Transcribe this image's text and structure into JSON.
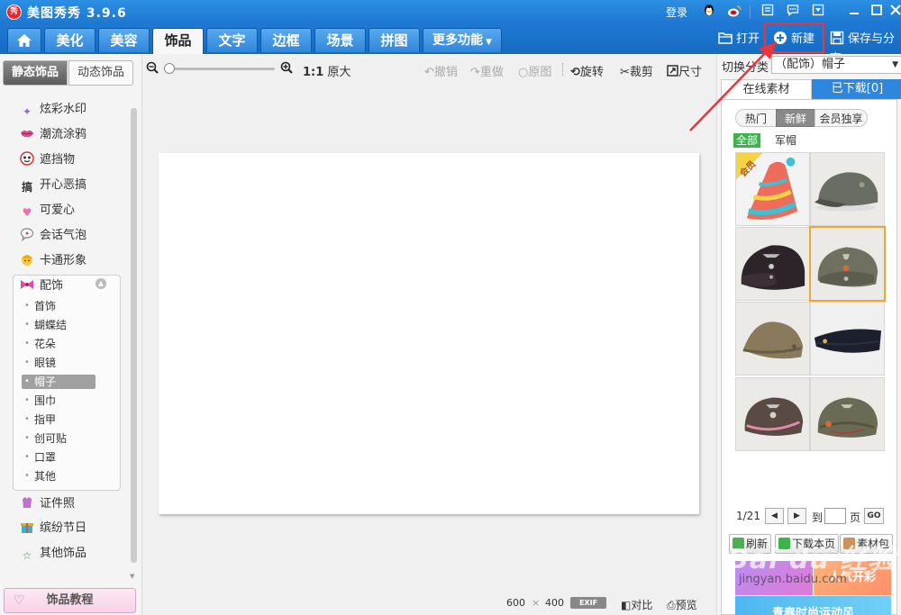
{
  "titlebar": {
    "app_title": "美图秀秀 3.9.6",
    "logo_text": "秀",
    "login": "登录"
  },
  "tabs": [
    {
      "label": "美化"
    },
    {
      "label": "美容"
    },
    {
      "label": "饰品",
      "active": true
    },
    {
      "label": "文字"
    },
    {
      "label": "边框"
    },
    {
      "label": "场景"
    },
    {
      "label": "拼图"
    }
  ],
  "more_tab": "更多功能",
  "actions": {
    "open": "打开",
    "new": "新建",
    "save_share": "保存与分享"
  },
  "left": {
    "subtab_static": "静态饰品",
    "subtab_dynamic": "动态饰品",
    "categories": [
      {
        "label": "炫彩水印",
        "icon": "sparkle-icon",
        "color": "#9a6bd8"
      },
      {
        "label": "潮流涂鸦",
        "icon": "lips-icon",
        "color": "#e04a8a"
      },
      {
        "label": "遮挡物",
        "icon": "mask-icon",
        "color": "#d33"
      },
      {
        "label": "开心恶搞",
        "icon": "prank-icon",
        "color": "#333"
      },
      {
        "label": "可爱心",
        "icon": "heart-icon",
        "color": "#f06bb0"
      },
      {
        "label": "会话气泡",
        "icon": "speech-bubble-icon",
        "color": "#888"
      },
      {
        "label": "卡通形象",
        "icon": "cartoon-icon",
        "color": "#f2a900"
      }
    ],
    "accessory_group": "配饰",
    "accessory_items": [
      "首饰",
      "蝴蝶结",
      "花朵",
      "眼镜",
      "帽子",
      "围巾",
      "指甲",
      "创可贴",
      "口罩",
      "其他"
    ],
    "selected_accessory": "帽子",
    "bottom_categories": [
      {
        "label": "证件照",
        "icon": "id-photo-icon",
        "color": "#c06fd0"
      },
      {
        "label": "缤纷节日",
        "icon": "gift-icon",
        "color": "#3bb0c9"
      },
      {
        "label": "其他饰品",
        "icon": "star-outline-icon",
        "color": "#3a9a4a"
      }
    ],
    "tutorial": "饰品教程"
  },
  "toolbar": {
    "ratio": "1:1",
    "original_size": "原大",
    "undo": "撤销",
    "redo": "重做",
    "original": "原图",
    "rotate": "旋转",
    "crop": "裁剪",
    "resize": "尺寸"
  },
  "status": {
    "width": "600",
    "times": "×",
    "height": "400",
    "exif": "EXIF",
    "compare": "对比",
    "preview": "预览"
  },
  "right": {
    "switch_label": "切换分类",
    "switch_value": "（配饰）帽子",
    "tab_online": "在线素材",
    "tab_downloaded": "已下载[0]",
    "filters": [
      "热门",
      "新鲜",
      "会员独享"
    ],
    "active_filter": "新鲜",
    "tags": [
      "全部",
      "军帽"
    ],
    "member_badge": "会员",
    "pager": {
      "current": "1/21",
      "goto": "到",
      "page": "页",
      "go": "GO"
    },
    "buttons": {
      "refresh": "刷新",
      "download_page": "下载本页",
      "material_pack": "素材包"
    },
    "banners": [
      "人气开彩",
      "青春时尚运动风"
    ]
  },
  "watermark": {
    "brand": "Bai du 经验",
    "url": "jingyan.baidu.com"
  },
  "colors": {
    "accent": "#1d76cf",
    "highlight": "#e8363a",
    "selected_thumb": "#f2a531",
    "tag_green": "#3bb54a"
  }
}
